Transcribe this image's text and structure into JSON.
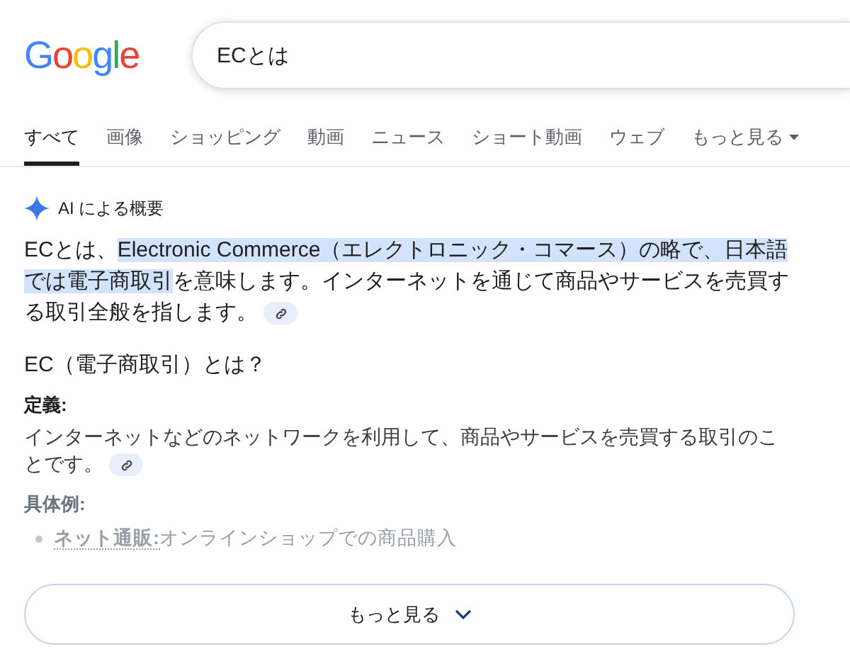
{
  "logo": {
    "text": "Google"
  },
  "search": {
    "value": "ECとは"
  },
  "tabs": [
    {
      "label": "すべて",
      "selected": true,
      "kind": "tab"
    },
    {
      "label": "画像",
      "selected": false,
      "kind": "tab"
    },
    {
      "label": "ショッピング",
      "selected": false,
      "kind": "tab"
    },
    {
      "label": "動画",
      "selected": false,
      "kind": "tab"
    },
    {
      "label": "ニュース",
      "selected": false,
      "kind": "tab"
    },
    {
      "label": "ショート動画",
      "selected": false,
      "kind": "tab"
    },
    {
      "label": "ウェブ",
      "selected": false,
      "kind": "tab"
    },
    {
      "label": "もっと見る",
      "selected": false,
      "kind": "menu"
    }
  ],
  "ai_overview": {
    "label": "AI による概要",
    "summary": [
      {
        "text": "ECとは、",
        "highlighted": false
      },
      {
        "text": "Electronic Commerce（エレクトロニック・コマース）の略で、日本語では電子商取引",
        "highlighted": true
      },
      {
        "text": "を意味します。インターネットを通じて商品やサービスを売買する取引全般を指します。",
        "highlighted": false
      }
    ],
    "heading": "EC（電子商取引）とは？",
    "sections": [
      {
        "title": "定義:",
        "text": "インターネットなどのネットワークを利用して、商品やサービスを売買する取引のことです。",
        "faded": false
      },
      {
        "title": "具体例:",
        "faded": true,
        "items": [
          {
            "term": "ネット通販:",
            "text": "オンラインショップでの商品購入"
          }
        ]
      }
    ],
    "more_button": "もっと見る"
  }
}
